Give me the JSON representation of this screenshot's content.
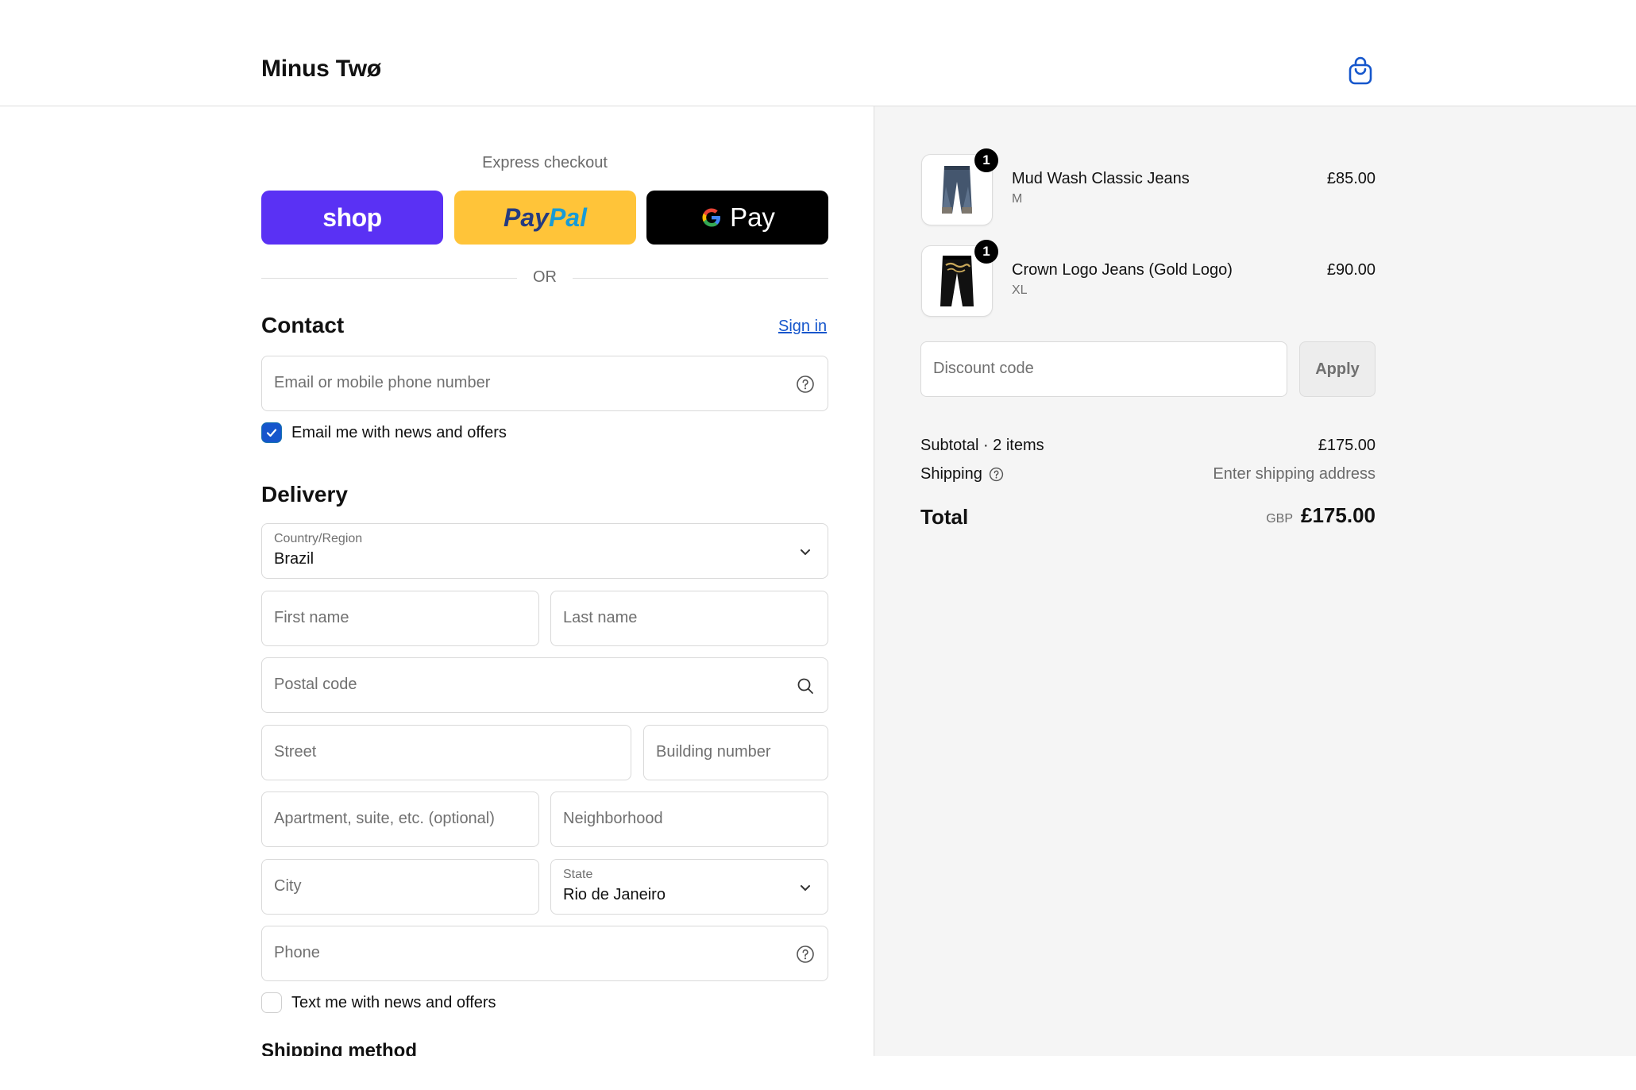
{
  "header": {
    "brand": "Minus Twø",
    "cart_icon": "shopping-bag-icon"
  },
  "express": {
    "title": "Express checkout",
    "shop_label": "shop",
    "paypal_part1": "Pay",
    "paypal_part2": "Pal",
    "gpay_label": "Pay",
    "divider": "OR"
  },
  "contact": {
    "title": "Contact",
    "sign_in": "Sign in",
    "email_placeholder": "Email or mobile phone number",
    "email_news_label": "Email me with news and offers",
    "email_news_checked": true
  },
  "delivery": {
    "title": "Delivery",
    "country_label": "Country/Region",
    "country_value": "Brazil",
    "first_name": "First name",
    "last_name": "Last name",
    "postal_code": "Postal code",
    "street": "Street",
    "building_number": "Building number",
    "apartment": "Apartment, suite, etc. (optional)",
    "neighborhood": "Neighborhood",
    "city": "City",
    "state_label": "State",
    "state_value": "Rio de Janeiro",
    "phone": "Phone",
    "sms_news_label": "Text me with news and offers",
    "sms_news_checked": false
  },
  "shipping_method": {
    "title": "Shipping method"
  },
  "order": {
    "items": [
      {
        "name": "Mud Wash Classic Jeans",
        "variant": "M",
        "price": "£85.00",
        "qty": "1"
      },
      {
        "name": "Crown Logo Jeans (Gold Logo)",
        "variant": "XL",
        "price": "£90.00",
        "qty": "1"
      }
    ],
    "discount_placeholder": "Discount code",
    "apply_label": "Apply",
    "subtotal_label": "Subtotal · 2 items",
    "subtotal_value": "£175.00",
    "shipping_label": "Shipping",
    "shipping_value": "Enter shipping address",
    "total_label": "Total",
    "total_currency": "GBP",
    "total_value": "£175.00"
  },
  "colors": {
    "shop_pay": "#5a31f4",
    "paypal": "#ffc439",
    "gpay": "#000000",
    "link": "#1556cc",
    "sidebar_bg": "#f5f5f5"
  }
}
